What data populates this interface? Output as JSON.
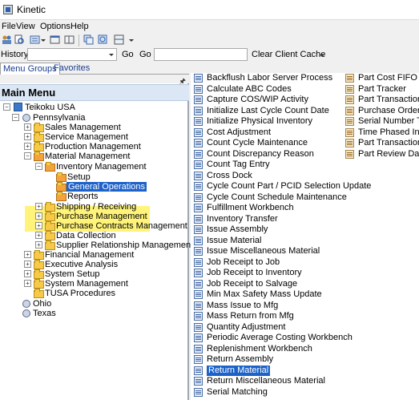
{
  "window": {
    "title": "Kinetic"
  },
  "menubar": [
    "File",
    "View",
    "Options",
    "Help"
  ],
  "history": {
    "label": "History:",
    "go1": "Go",
    "go2": "Go",
    "clear_cache": "Clear Client Cache"
  },
  "tabs": {
    "menu_groups": "Menu Groups",
    "favorites": "Favorites"
  },
  "main_menu": {
    "title": "Main Menu"
  },
  "tree": {
    "company": "Teikoku USA",
    "site_pennsylvania": "Pennsylvania",
    "sales_management": "Sales Management",
    "service_management": "Service Management",
    "production_management": "Production Management",
    "material_management": "Material Management",
    "inventory_management": "Inventory Management",
    "setup": "Setup",
    "general_operations": "General Operations",
    "reports": "Reports",
    "shipping_receiving": "Shipping / Receiving",
    "purchase_management": "Purchase Management",
    "purchase_contracts_management": "Purchase Contracts Management",
    "data_collection": "Data Collection",
    "supplier_relationship_management": "Supplier Relationship Management",
    "financial_management": "Financial Management",
    "executive_analysis": "Executive Analysis",
    "system_setup": "System Setup",
    "system_management": "System Management",
    "tusa_procedures": "TUSA Procedures",
    "site_ohio": "Ohio",
    "site_texas": "Texas"
  },
  "programs_col1": [
    "Backflush Labor Server Process",
    "Calculate ABC Codes",
    "Capture COS/WIP Activity",
    "Initialize Last Cycle Count Date",
    "Initialize Physical Inventory",
    "Cost Adjustment",
    "Count Cycle Maintenance",
    "Count Discrepancy Reason",
    "Count Tag Entry",
    "Cross Dock",
    "Cycle Count Part / PCID Selection Update",
    "Cycle Count Schedule Maintenance",
    "Fulfillment Workbench",
    "Inventory Transfer",
    "Issue Assembly",
    "Issue Material",
    "Issue Miscellaneous Material",
    "Job Receipt to Job",
    "Job Receipt to Inventory",
    "Job Receipt to Salvage",
    "Min Max Safety Mass Update",
    "Mass Issue to Mfg",
    "Mass Return from Mfg",
    "Quantity Adjustment",
    "Periodic Average Costing Workbench",
    "Replenishment Workbench",
    "Return Assembly",
    "Return Material",
    "Return Miscellaneous Material",
    "Serial Matching"
  ],
  "programs_col2": [
    "Part Cost FIFO Track",
    "Part Tracker",
    "Part Transaction Hist",
    "Purchase Order Track",
    "Serial Number Tracke",
    "Time Phased Inquiry",
    "Part Transaction Hist",
    "Part Review Dashbo"
  ],
  "selected_program": "Return Material"
}
